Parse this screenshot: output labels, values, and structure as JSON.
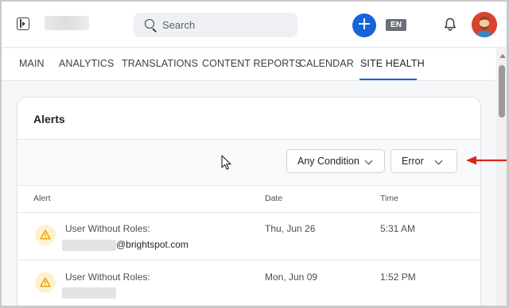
{
  "topbar": {
    "search_placeholder": "Search",
    "language_badge": "EN",
    "brand_color": "#1565d8"
  },
  "tabs": [
    {
      "label": "MAIN"
    },
    {
      "label": "ANALYTICS"
    },
    {
      "label": "TRANSLATIONS"
    },
    {
      "label": "CONTENT REPORTS"
    },
    {
      "label": "CALENDAR"
    },
    {
      "label": "SITE HEALTH",
      "active": true
    }
  ],
  "alerts_card": {
    "title": "Alerts",
    "filters": {
      "condition_value": "Any Condition",
      "severity_value": "Error"
    },
    "columns": {
      "alert": "Alert",
      "date": "Date",
      "time": "Time"
    },
    "rows": [
      {
        "icon": "warning-icon",
        "title": "User Without Roles:",
        "email_suffix": "@brightspot.com",
        "date": "Thu, Jun 26",
        "time": "5:31 AM"
      },
      {
        "icon": "warning-icon",
        "title": "User Without Roles:",
        "email_suffix": "",
        "date": "Mon, Jun 09",
        "time": "1:52 PM"
      }
    ]
  },
  "colors": {
    "annotation_arrow": "#d7261e",
    "warning_bg": "#fdf1cf",
    "warning_icon": "#f2a400",
    "avatar_bg": "#d9432e"
  }
}
